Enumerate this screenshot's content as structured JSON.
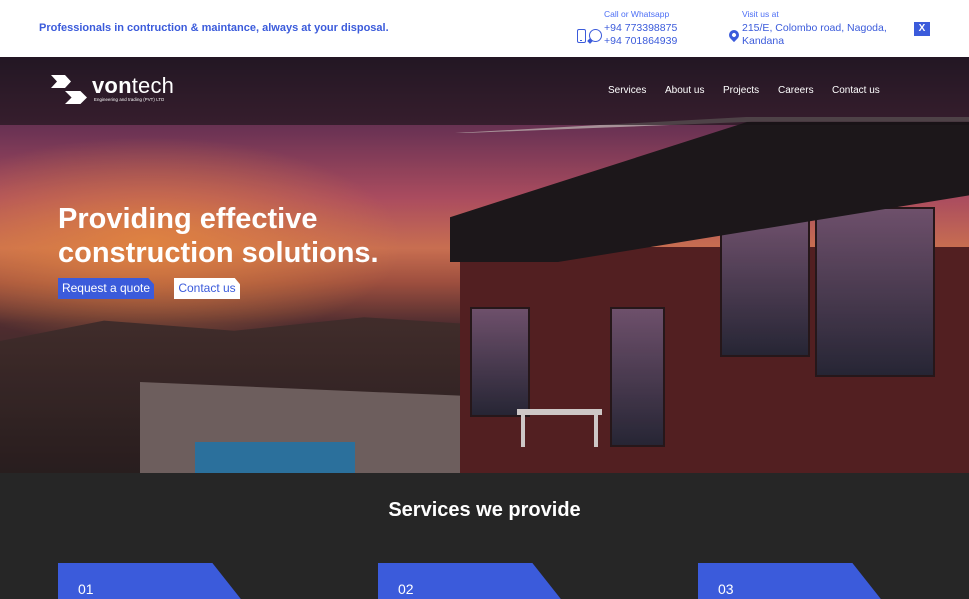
{
  "topbar": {
    "tagline": "Professionals in contruction & maintance, always at your disposal.",
    "call": {
      "label": "Call or Whatsapp",
      "phone1": "+94 773398875",
      "phone2": "+94 701864939"
    },
    "visit": {
      "label": "Visit us at",
      "line1": "215/E, Colombo road, Nagoda,",
      "line2": "Kandana"
    },
    "close_label": "X"
  },
  "brand": {
    "name_bold": "von",
    "name_rest": "tech",
    "subtitle": "Engineering and trading (PVT) LTD"
  },
  "nav": {
    "items": [
      "Services",
      "About us",
      "Projects",
      "Careers",
      "Contact us"
    ]
  },
  "hero": {
    "title_line1": "Providing effective",
    "title_line2": "construction solutions.",
    "primary_button": "Request a quote",
    "secondary_button": "Contact us"
  },
  "services": {
    "title": "Services we provide",
    "cards": [
      {
        "number": "01"
      },
      {
        "number": "02"
      },
      {
        "number": "03"
      }
    ]
  },
  "colors": {
    "accent": "#3b5bdb",
    "dark_section": "#262626",
    "nav_overlay": "#19121680"
  },
  "icons": [
    "phone-icon",
    "whatsapp-icon",
    "location-pin-icon",
    "close-icon"
  ]
}
